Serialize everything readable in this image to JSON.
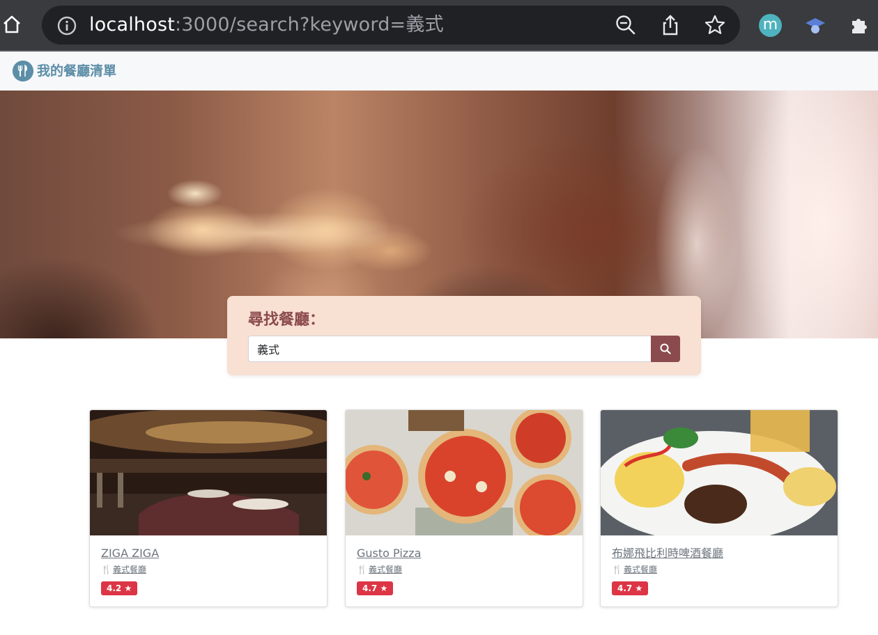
{
  "browser": {
    "url_host": "localhost",
    "url_rest": ":3000/search?keyword=義式",
    "avatar_letter": "m"
  },
  "navbar": {
    "brand": "我的餐廳清單"
  },
  "search": {
    "title": "尋找餐廳：",
    "value": "義式"
  },
  "restaurants": [
    {
      "name": "ZIGA ZIGA",
      "category": "義式餐廳",
      "rating": "4.2"
    },
    {
      "name": "Gusto Pizza",
      "category": "義式餐廳",
      "rating": "4.7"
    },
    {
      "name": "布娜飛比利時啤酒餐廳",
      "category": "義式餐廳",
      "rating": "4.7"
    }
  ],
  "colors": {
    "brand": "#5c8ea7",
    "accent": "#8b4b4e",
    "panel": "#f8e0d3",
    "badge": "#dc3545"
  }
}
